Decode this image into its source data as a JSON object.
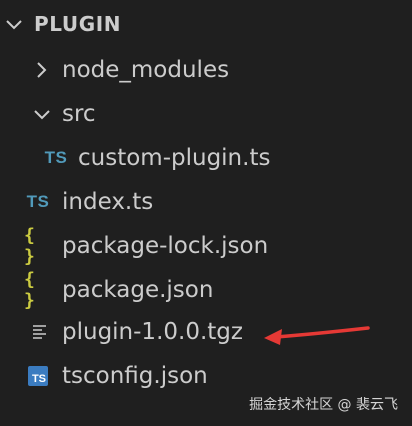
{
  "explorer": {
    "section_title": "PLUGIN",
    "items": [
      {
        "label": "node_modules",
        "kind": "folder",
        "state": "collapsed",
        "icon": "chevron-right-icon"
      },
      {
        "label": "src",
        "kind": "folder",
        "state": "expanded",
        "icon": "chevron-down-icon"
      },
      {
        "label": "custom-plugin.ts",
        "kind": "file",
        "icon_text": "TS",
        "icon": "typescript-file-icon"
      },
      {
        "label": "index.ts",
        "kind": "file",
        "icon_text": "TS",
        "icon": "typescript-file-icon"
      },
      {
        "label": "package-lock.json",
        "kind": "file",
        "icon_text": "{ }",
        "icon": "json-file-icon"
      },
      {
        "label": "package.json",
        "kind": "file",
        "icon_text": "{ }",
        "icon": "json-file-icon"
      },
      {
        "label": "plugin-1.0.0.tgz",
        "kind": "file",
        "icon": "archive-file-icon"
      },
      {
        "label": "tsconfig.json",
        "kind": "file",
        "icon_text": "TS",
        "icon": "tsconfig-file-icon"
      }
    ]
  },
  "annotation": {
    "arrow_color": "#e53935",
    "points_to": "plugin-1.0.0.tgz"
  },
  "watermark": "掘金技术社区 @ 裴云飞",
  "colors": {
    "background": "#1f1f1f",
    "text": "#cccccc",
    "ts_icon": "#519aba",
    "json_icon": "#cbcb41",
    "tsconfig_icon_bg": "#3b7cc0"
  }
}
